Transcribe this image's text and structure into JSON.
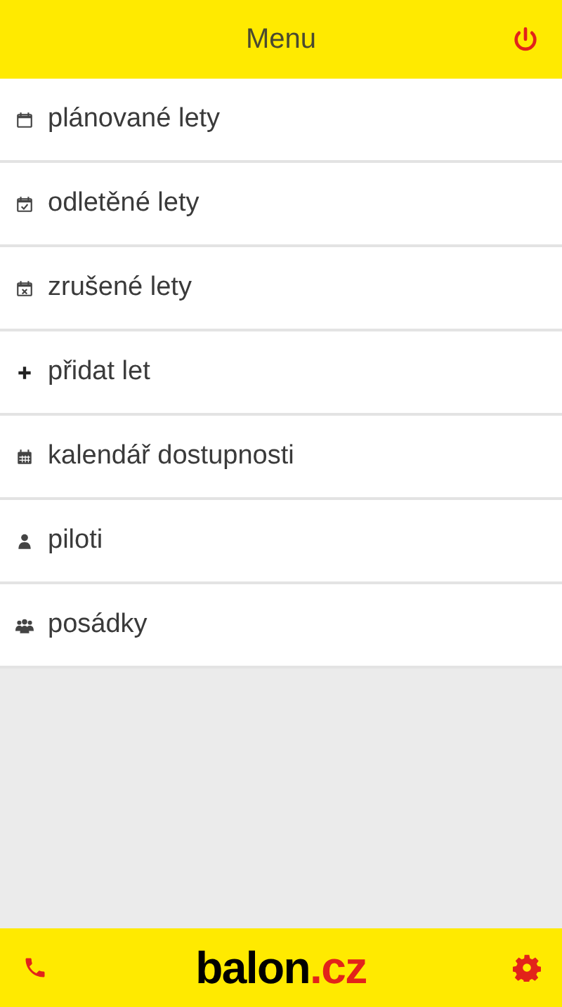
{
  "header": {
    "title": "Menu"
  },
  "menu": [
    {
      "label": "plánované lety"
    },
    {
      "label": "odletěné lety"
    },
    {
      "label": "zrušené lety"
    },
    {
      "label": "přidat let"
    },
    {
      "label": "kalendář dostupnosti"
    },
    {
      "label": "piloti"
    },
    {
      "label": "posádky"
    }
  ],
  "footer": {
    "logo": {
      "main": "balon",
      "suffix": ".cz"
    }
  }
}
